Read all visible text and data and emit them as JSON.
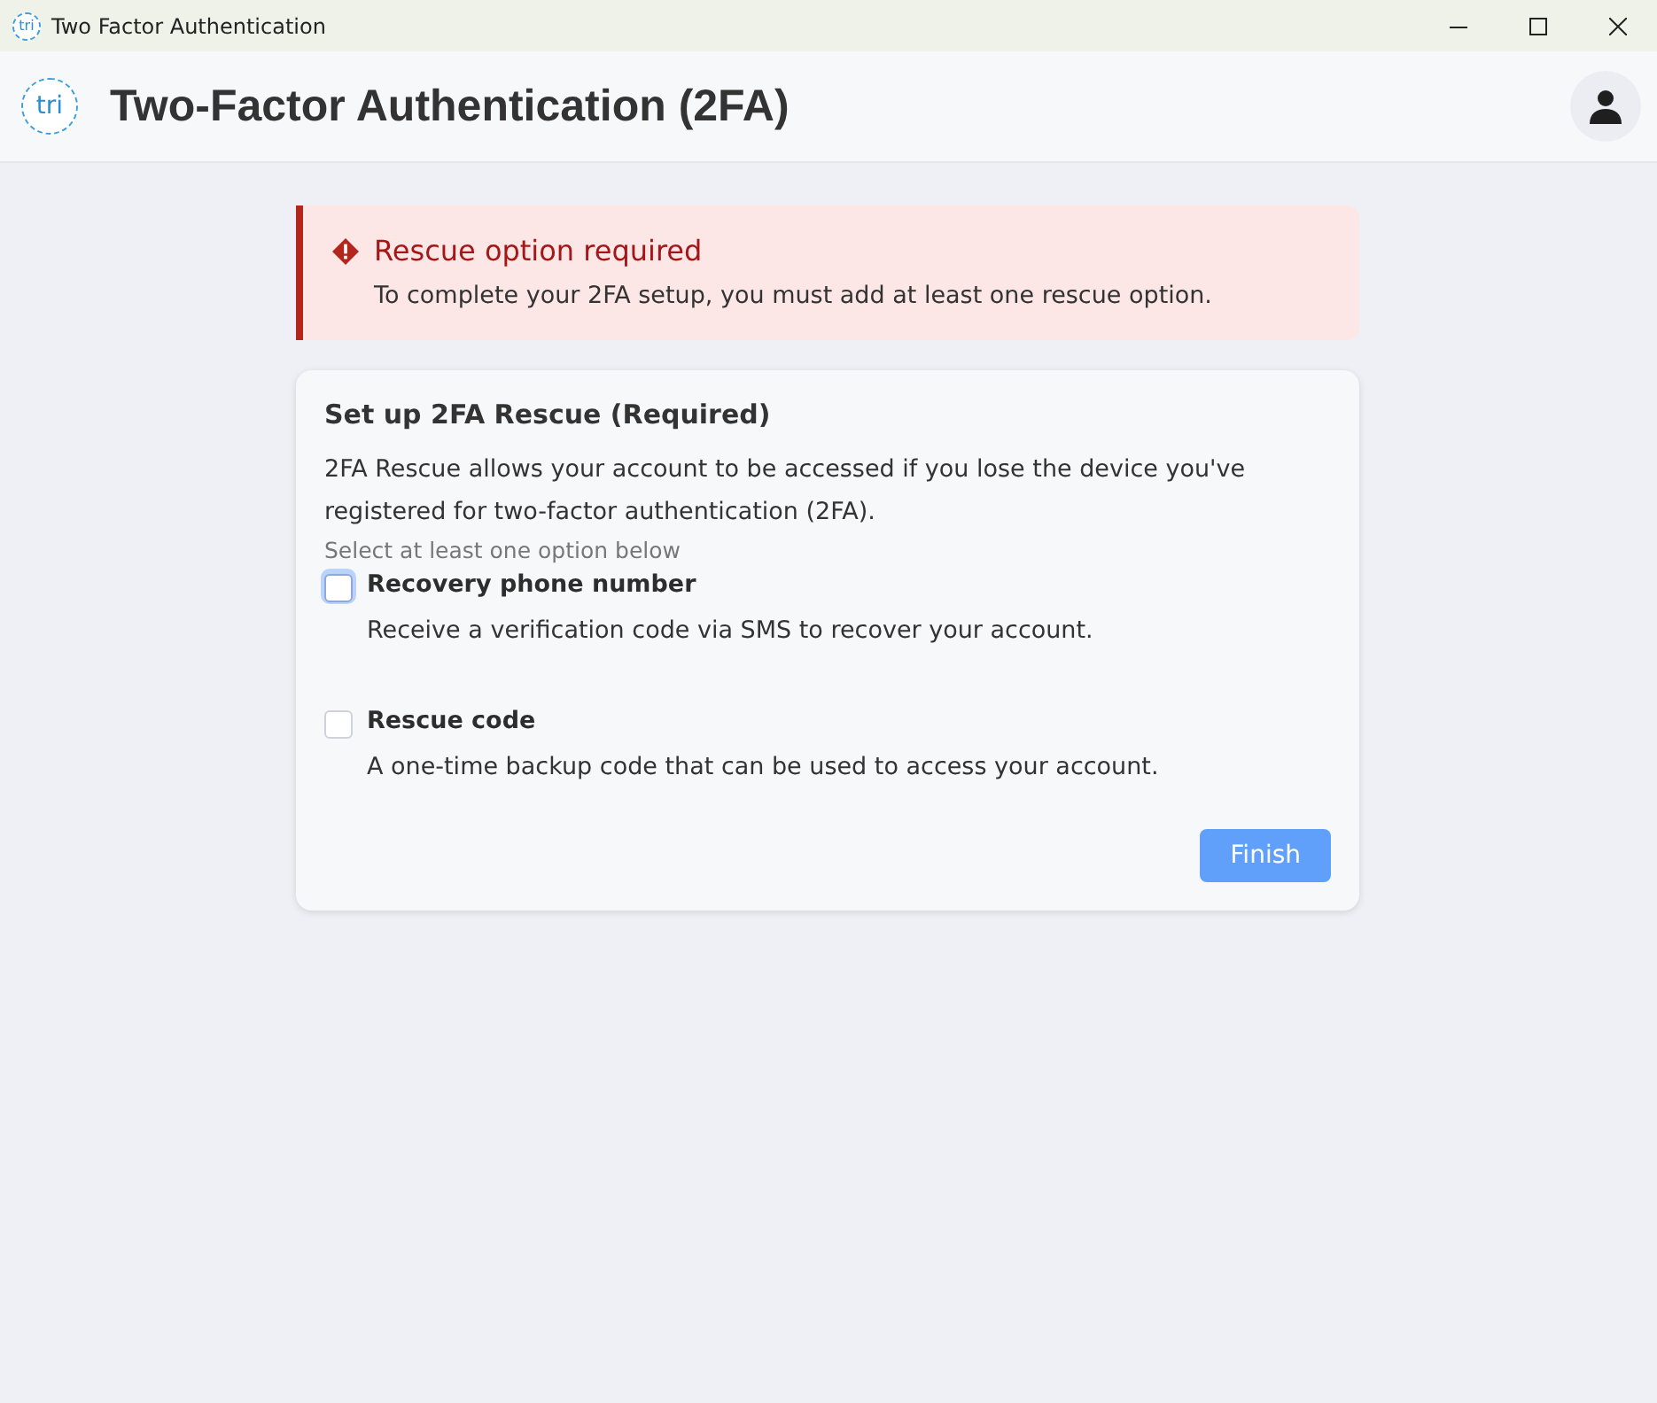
{
  "window": {
    "title": "Two Factor Authentication",
    "logo_text": "tri"
  },
  "header": {
    "logo_text": "tri",
    "title": "Two-Factor Authentication (2FA)"
  },
  "alert": {
    "title": "Rescue option required",
    "message": "To complete your 2FA setup, you must add at least one rescue option."
  },
  "card": {
    "title": "Set up 2FA Rescue (Required)",
    "description": "2FA Rescue allows your account to be accessed if you lose the device you've registered for two-factor authentication (2FA).",
    "hint": "Select at least one option below",
    "options": [
      {
        "label": "Recovery phone number",
        "description": "Receive a verification code via SMS to recover your account.",
        "checked": false,
        "focused": true
      },
      {
        "label": "Rescue code",
        "description": "A one-time backup code that can be used to access your account.",
        "checked": false,
        "focused": false
      }
    ],
    "button": {
      "label": "Finish",
      "disabled": true
    }
  }
}
